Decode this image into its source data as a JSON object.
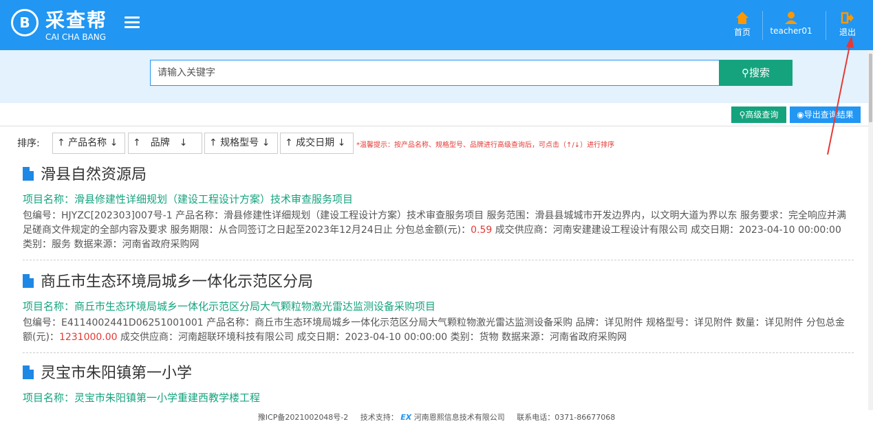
{
  "header": {
    "logo_mark": "B",
    "logo_cn": "采查帮",
    "logo_en": "CAI CHA BANG",
    "nav": {
      "home_label": "首页",
      "user_label": "teacher01",
      "logout_label": "退出"
    }
  },
  "search": {
    "placeholder": "请输入关键字",
    "button_label": "⚲搜索"
  },
  "toolbar": {
    "advanced_label": "⚲高级查询",
    "export_label": "◉导出查询结果"
  },
  "sort": {
    "label": "排序:",
    "buttons": [
      "↑ 产品名称 ↓",
      "↑　品牌　↓",
      "↑ 规格型号 ↓",
      "↑ 成交日期 ↓"
    ],
    "hint": "*温馨提示：按产品名称、规格型号、品牌进行高级查询后，可点击（↑/↓）进行排序"
  },
  "results": [
    {
      "org": "滑县自然资源局",
      "project": "项目名称：滑县修建性详细规划（建设工程设计方案）技术审查服务项目",
      "detail_pre": "包编号：HJYZC[202303]007号-1  产品名称：滑县修建性详细规划（建设工程设计方案）技术审查服务项目  服务范围：滑县县城城市开发边界内，以文明大道为界以东  服务要求：完全响应并满足磋商文件规定的全部内容及要求  服务期限：从合同签订之日起至2023年12月24日止  分包总金额(元)：",
      "amount": "0.59",
      "detail_post": "  成交供应商：河南安建建设工程设计有限公司  成交日期：2023-04-10 00:00:00  类别：服务  数据来源：河南省政府采购网"
    },
    {
      "org": "商丘市生态环境局城乡一体化示范区分局",
      "project": "项目名称：商丘市生态环境局城乡一体化示范区分局大气颗粒物激光雷达监测设备采购项目",
      "detail_pre": "包编号：E4114002441D06251001001  产品名称：商丘市生态环境局城乡一体化示范区分局大气颗粒物激光雷达监测设备采购  品牌：详见附件  规格型号：详见附件  数量：详见附件  分包总金额(元)：",
      "amount": "1231000.00",
      "detail_post": "  成交供应商：河南超联环境科技有限公司  成交日期：2023-04-10 00:00:00  类别：货物  数据来源：河南省政府采购网"
    },
    {
      "org": "灵宝市朱阳镇第一小学",
      "project": "项目名称：灵宝市朱阳镇第一小学重建西教学楼工程",
      "detail_pre": "",
      "amount": "",
      "detail_post": ""
    }
  ],
  "footer": {
    "icp": "豫ICP备2021002048号-2",
    "support_label": "技术支持：",
    "ex_mark": "EX",
    "company": "河南恩熙信息技术有限公司",
    "phone": "联系电话：0371-86677068"
  },
  "colors": {
    "header_bg": "#2196f3",
    "search_band": "#e3f2fd",
    "accent_green": "#15a37e",
    "amount_red": "#e53935",
    "annotation_arrow": "#e53935"
  }
}
